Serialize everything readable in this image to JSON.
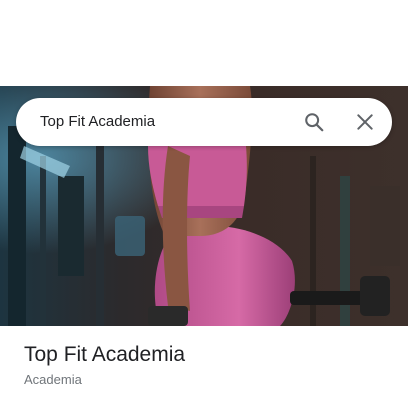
{
  "search": {
    "query": "Top Fit Academia"
  },
  "place": {
    "name": "Top Fit Academia",
    "category": "Academia"
  },
  "icons": {
    "search": "search-icon",
    "close": "close-icon"
  },
  "colors": {
    "text_primary": "#202124",
    "text_secondary": "#70757a",
    "icon": "#5f6368"
  }
}
